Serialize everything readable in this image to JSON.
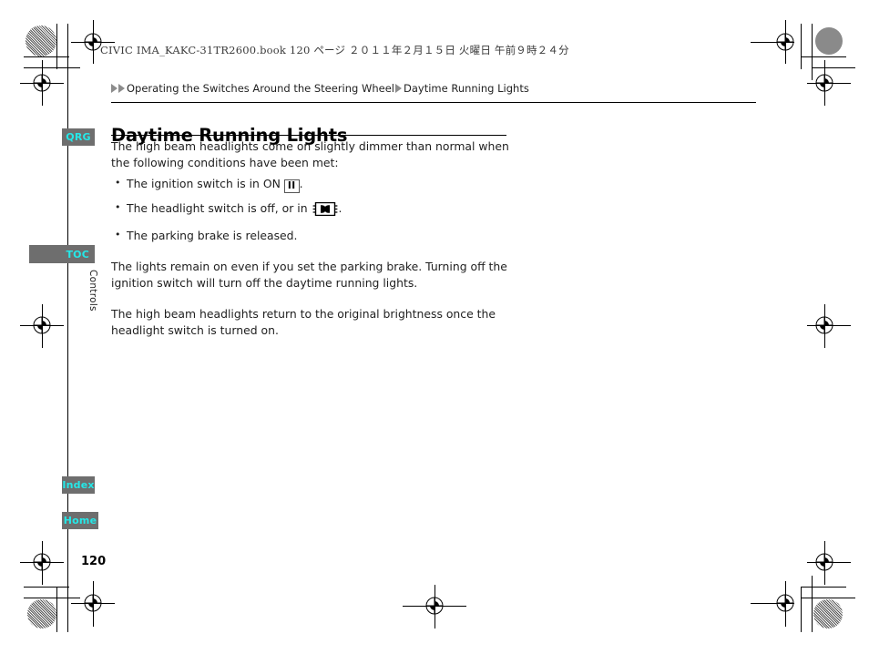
{
  "printer_slug": "CIVIC  IMA_KAKC-31TR2600.book   120 ページ   ２０１１年２月１５日   火曜日   午前９時２４分",
  "breadcrumb": {
    "parent": "Operating the Switches Around the Steering Wheel",
    "current": "Daytime Running Lights"
  },
  "title": "Daytime Running Lights",
  "content": {
    "intro": "The high beam headlights come on slightly dimmer than normal when the following conditions have been met:",
    "bullets": [
      {
        "before": "The ignition switch is in ON",
        "symbol": "ignition-on-icon",
        "symbol_label": "II",
        "after": "."
      },
      {
        "before": "The headlight switch is off, or in",
        "symbol": "position-light-icon",
        "symbol_label": "",
        "after": "."
      },
      {
        "before": "The parking brake is released.",
        "symbol": "",
        "symbol_label": "",
        "after": ""
      }
    ],
    "paragraph_2": "The lights remain on even if you set the parking brake. Turning off the ignition switch will turn off the daytime running lights.",
    "paragraph_3": "The high beam headlights return to the original brightness once the headlight switch is turned on."
  },
  "nav": {
    "qrg": "QRG",
    "toc": "TOC",
    "index": "Index",
    "home": "Home",
    "section_label": "Controls"
  },
  "page_number": "120",
  "colors": {
    "nav_button_bg": "#6e6e6e",
    "nav_button_text": "#25e8e8",
    "breadcrumb_arrow": "#8c8c8c",
    "rule": "#000000"
  }
}
